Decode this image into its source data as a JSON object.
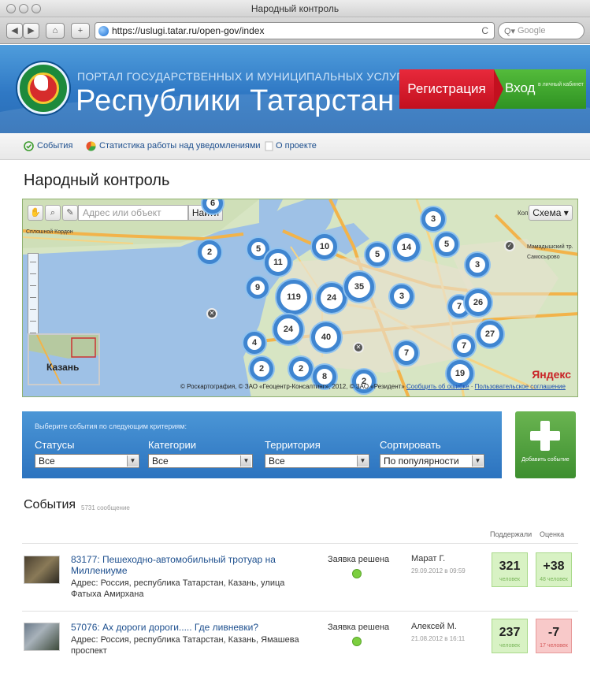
{
  "window": {
    "title": "Народный контроль"
  },
  "browser": {
    "url": "https://uslugi.tatar.ru/open-gov/index",
    "search_placeholder": "Google",
    "reload_label": "C"
  },
  "header": {
    "portal_line": "ПОРТАЛ ГОСУДАРСТВЕННЫХ И МУНИЦИПАЛЬНЫХ УСЛУГ",
    "portal_title": "Республики Татарстан",
    "register_label": "Регистрация",
    "login_label": "Вход",
    "login_sub": "в личный кабинет",
    "colors": {
      "register": "#d71a2a",
      "login": "#3fa32d"
    }
  },
  "nav": {
    "items": [
      {
        "label": "События",
        "icon": "check-circle-icon"
      },
      {
        "label": "Статистика работы над уведомлениями",
        "icon": "pie-chart-icon"
      },
      {
        "label": "О проекте",
        "icon": "document-icon"
      }
    ]
  },
  "page": {
    "title": "Народный контроль"
  },
  "map": {
    "search_placeholder": "Адрес или объект",
    "find_label": "Найти",
    "scheme_label": "Схема",
    "minimap_label": "Казань",
    "copyright": "© Роскартография, © ЗАО «Геоцентр-Консалтинг», 2012, © ЗАО «Резидент»",
    "report_error": "Сообщить об ошибке",
    "terms": "Пользовательское соглашение",
    "yandex": "Яндекс",
    "places": [
      "Самосырово",
      "Мамадышский тр.",
      "Коп",
      "Сплошной Кордон"
    ],
    "clusters": [
      "6",
      "3",
      "5",
      "2",
      "5",
      "10",
      "14",
      "5",
      "11",
      "3",
      "9",
      "119",
      "24",
      "35",
      "3",
      "7",
      "26",
      "24",
      "40",
      "4",
      "7",
      "27",
      "2",
      "2",
      "8",
      "2",
      "7",
      "19"
    ]
  },
  "filters": {
    "hint": "Выберите события по следующим критериям:",
    "fields": [
      {
        "label": "Статусы",
        "value": "Все"
      },
      {
        "label": "Категории",
        "value": "Все"
      },
      {
        "label": "Территория",
        "value": "Все"
      },
      {
        "label": "Сортировать",
        "value": "По популярности"
      }
    ],
    "add_label": "Добавить событие"
  },
  "events": {
    "title": "События",
    "count": "5731 сообщение",
    "col_support": "Поддержали",
    "col_rating": "Оценка",
    "items": [
      {
        "title": "83177: Пешеходно-автомобильный тротуар на Миллениуме",
        "address": "Адрес: Россия, республика Татарстан, Казань, улица Фатыха Амирхана",
        "status": "Заявка решена",
        "user": "Марат Г.",
        "date": "29.09.2012 в 09:59",
        "support": "321",
        "support_sub": "человек",
        "rating": "+38",
        "rating_sub": "48 человек"
      },
      {
        "title": "57076: Ах дороги дороги..... Где ливневки?",
        "address": "Адрес: Россия, республика Татарстан, Казань, Ямашева проспект",
        "status": "Заявка решена",
        "user": "Алексей М.",
        "date": "21.08.2012 в 16:11",
        "support": "237",
        "support_sub": "человек",
        "rating": "-7",
        "rating_sub": "17 человек"
      }
    ]
  }
}
